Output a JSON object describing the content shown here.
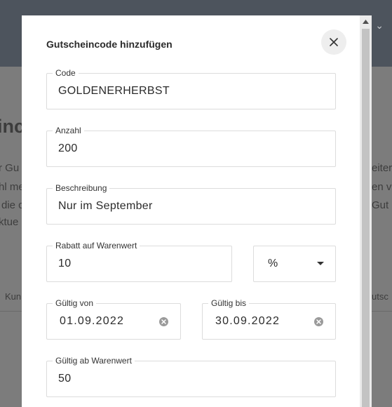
{
  "background": {
    "heading_partial": "inc",
    "lines_left": [
      "r Gu",
      "hl me",
      "die c",
      "ktue"
    ],
    "lines_right": [
      "eiter",
      "en v",
      "Gut"
    ],
    "tab_left": "Kun",
    "tab_right": "utsc"
  },
  "modal": {
    "title": "Gutscheincode hinzufügen",
    "close_icon": "close-icon",
    "fields": {
      "code": {
        "label": "Code",
        "value": "GOLDENERHERBST"
      },
      "count": {
        "label": "Anzahl",
        "value": "200"
      },
      "description": {
        "label": "Beschreibung",
        "value": "Nur im September"
      },
      "discount": {
        "label": "Rabatt auf Warenwert",
        "value": "10"
      },
      "discount_unit": {
        "value": "%"
      },
      "valid_from": {
        "label": "Gültig von",
        "value": "01.09.2022"
      },
      "valid_to": {
        "label": "Gültig bis",
        "value": "30.09.2022"
      },
      "min_order": {
        "label": "Gültig ab Warenwert",
        "value": "50"
      }
    }
  },
  "colors": {
    "overlay": "#7c7c7c",
    "modal_bg": "#ffffff",
    "border": "#dcdcdc"
  }
}
